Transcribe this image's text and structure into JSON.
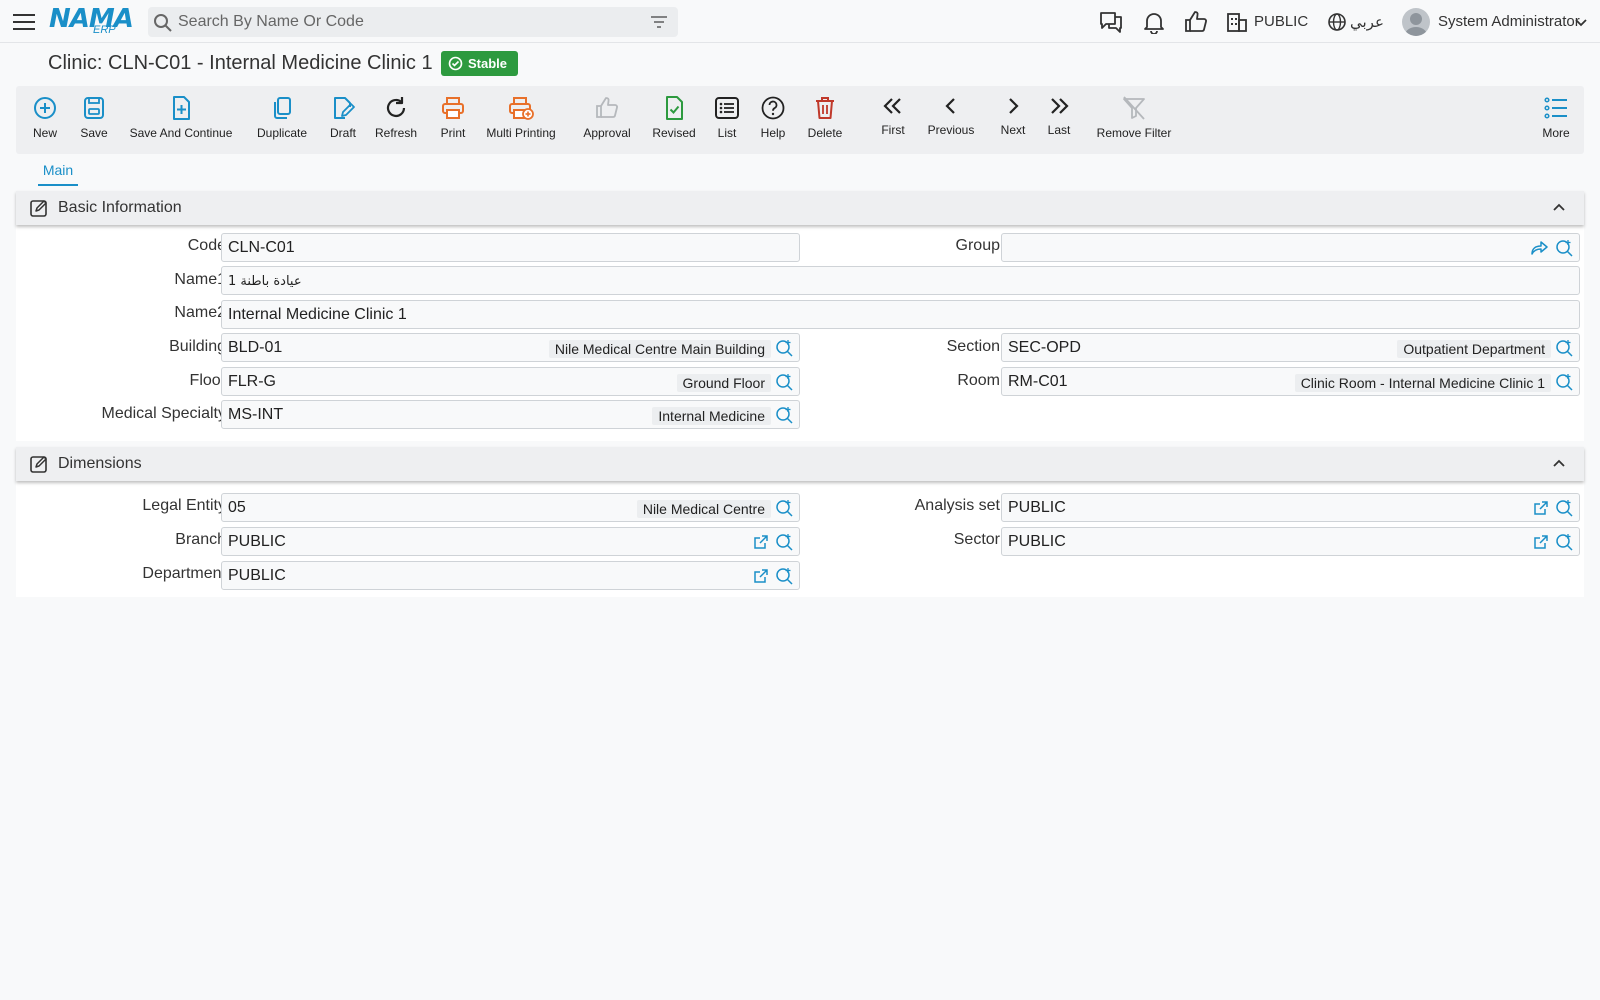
{
  "header": {
    "logo_main": "NAMA",
    "logo_sub": "ERP",
    "search_placeholder": "Search By Name Or Code",
    "company": "PUBLIC",
    "language": "عربي",
    "user": "System Administrator"
  },
  "page": {
    "title": "Clinic: CLN-C01 - Internal Medicine Clinic 1",
    "status": "Stable"
  },
  "toolbar": {
    "new": "New",
    "save": "Save",
    "save_continue": "Save And Continue",
    "duplicate": "Duplicate",
    "draft": "Draft",
    "refresh": "Refresh",
    "print": "Print",
    "multi_printing": "Multi Printing",
    "approval": "Approval",
    "revised": "Revised",
    "list": "List",
    "help": "Help",
    "delete": "Delete",
    "first": "First",
    "previous": "Previous",
    "next": "Next",
    "last": "Last",
    "remove_filter": "Remove Filter",
    "more": "More"
  },
  "tabs": {
    "main": "Main"
  },
  "basic": {
    "title": "Basic Information",
    "code_label": "Code",
    "code": "CLN-C01",
    "group_label": "Group",
    "group": "",
    "name1_label": "Name1",
    "name1": "عيادة باطنة 1",
    "name2_label": "Name2",
    "name2": "Internal Medicine Clinic 1",
    "building_label": "Building",
    "building_code": "BLD-01",
    "building_name": "Nile Medical Centre Main Building",
    "section_label": "Section",
    "section_code": "SEC-OPD",
    "section_name": "Outpatient Department",
    "floor_label": "Floor",
    "floor_code": "FLR-G",
    "floor_name": "Ground Floor",
    "room_label": "Room",
    "room_code": "RM-C01",
    "room_name": "Clinic Room - Internal Medicine Clinic 1",
    "specialty_label": "Medical Specialty",
    "specialty_code": "MS-INT",
    "specialty_name": "Internal Medicine"
  },
  "dimensions": {
    "title": "Dimensions",
    "legal_label": "Legal Entity",
    "legal_code": "05",
    "legal_name": "Nile Medical Centre",
    "analysis_label": "Analysis set",
    "analysis": "PUBLIC",
    "branch_label": "Branch",
    "branch": "PUBLIC",
    "sector_label": "Sector",
    "sector": "PUBLIC",
    "department_label": "Department",
    "department": "PUBLIC"
  },
  "colors": {
    "accent": "#1a8fc8",
    "orange": "#e8702a",
    "green": "#2d9a3f",
    "red": "#c0392b"
  }
}
